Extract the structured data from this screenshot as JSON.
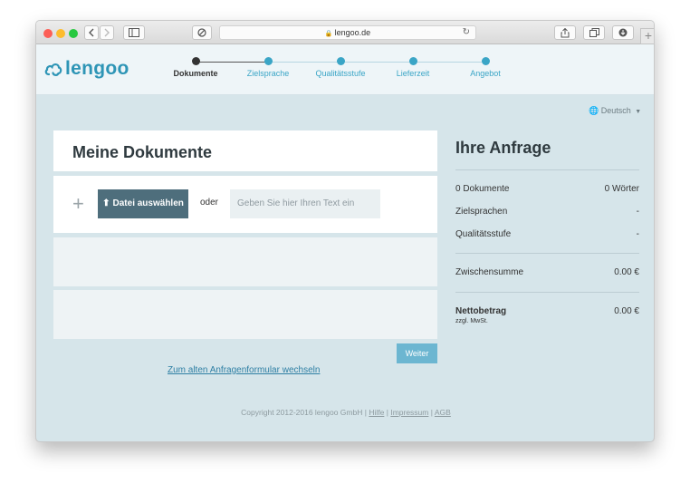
{
  "browser": {
    "url": "lengoo.de"
  },
  "header": {
    "logo_text": "lengoo",
    "steps": [
      {
        "label": "Dokumente",
        "active": true
      },
      {
        "label": "Zielsprache",
        "active": false
      },
      {
        "label": "Qualitätsstufe",
        "active": false
      },
      {
        "label": "Lieferzeit",
        "active": false
      },
      {
        "label": "Angebot",
        "active": false
      }
    ]
  },
  "language": {
    "label": "Deutsch"
  },
  "documents": {
    "title": "Meine Dokumente",
    "upload_label": "Datei auswählen",
    "or_label": "oder",
    "text_placeholder": "Geben Sie hier Ihren Text ein",
    "next_label": "Weiter",
    "old_form_link": "Zum alten Anfragenformular wechseln"
  },
  "summary": {
    "title": "Ihre Anfrage",
    "documents_label": "0 Dokumente",
    "words_value": "0 Wörter",
    "languages_label": "Zielsprachen",
    "languages_value": "-",
    "quality_label": "Qualitätsstufe",
    "quality_value": "-",
    "subtotal_label": "Zwischensumme",
    "subtotal_value": "0.00 €",
    "net_label": "Nettobetrag",
    "net_note": "zzgl. MwSt.",
    "net_value": "0.00 €"
  },
  "footer": {
    "copyright": "Copyright 2012-2016 lengoo GmbH",
    "sep": "|",
    "help": "Hilfe",
    "imprint": "Impressum",
    "terms": "AGB"
  },
  "colors": {
    "accent": "#3aa5c6",
    "button_dark": "#4e6e7c",
    "background": "#d6e5ea"
  }
}
